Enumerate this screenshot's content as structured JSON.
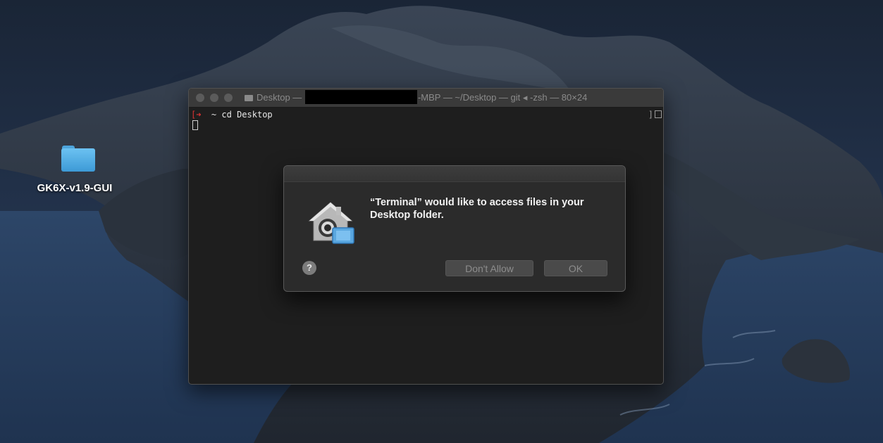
{
  "desktop": {
    "folder_label": "GK6X-v1.9-GUI"
  },
  "terminal": {
    "title_prefix": "Desktop —",
    "title_suffix": "-MBP — ~/Desktop — git ◂ -zsh — 80×24",
    "prompt_bracket": "[",
    "prompt_arrow": "➜",
    "prompt_tilde": "~",
    "command": "cd Desktop",
    "scroll_mark": "]"
  },
  "dialog": {
    "message": "“Terminal” would like to access files in your Desktop folder.",
    "help_label": "?",
    "deny_label": "Don't Allow",
    "ok_label": "OK"
  },
  "colors": {
    "terminal_bg": "#1e1e1e",
    "dialog_bg": "#2b2b2b",
    "prompt_red": "#dd3333",
    "folder_blue": "#5ab4ea"
  }
}
